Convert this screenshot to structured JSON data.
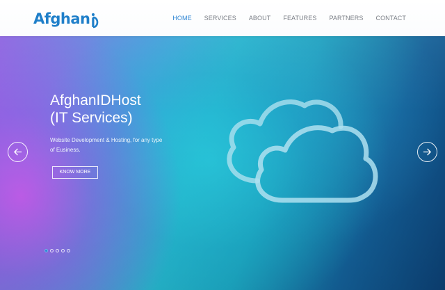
{
  "header": {
    "logo_text": "Afghan",
    "nav": [
      {
        "label": "HOME",
        "active": true
      },
      {
        "label": "SERVICES",
        "active": false
      },
      {
        "label": "ABOUT",
        "active": false
      },
      {
        "label": "FEATURES",
        "active": false
      },
      {
        "label": "PARTNERS",
        "active": false
      },
      {
        "label": "CONTACT",
        "active": false
      }
    ]
  },
  "hero": {
    "title_line1": "AfghanIDHost",
    "title_line2": "(IT Services)",
    "subtitle": "Website Development & Hosting, for any type of Eusiness.",
    "button_label": "KNOW MORE",
    "prev_icon": "arrow-left-icon",
    "next_icon": "arrow-right-icon",
    "illustration_icon": "cloud-icon"
  },
  "slider": {
    "slide_count": 5,
    "active_index": 0
  },
  "colors": {
    "brand_blue": "#1f7fc9",
    "nav_active": "#2f86d4",
    "nav_inactive": "#7b7f86"
  }
}
